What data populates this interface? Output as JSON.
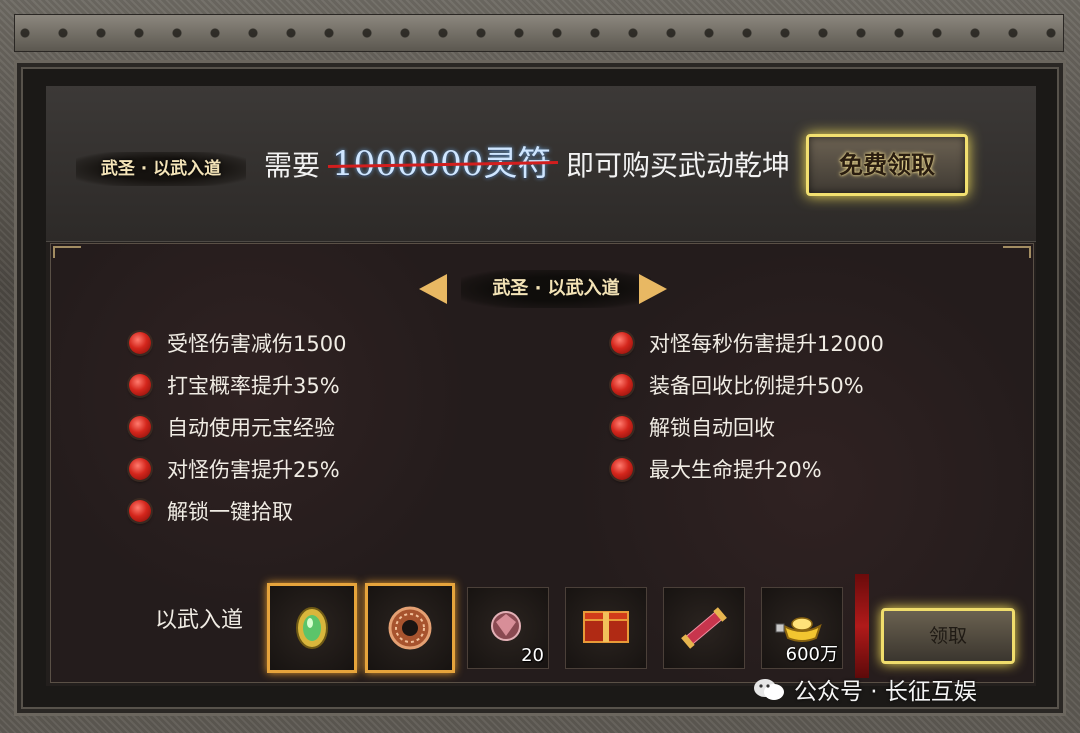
{
  "banner": {
    "badge": "武圣 · 以武入道",
    "need_text": "需要",
    "price": "1000000灵符",
    "suffix": "即可购买武动乾坤",
    "free_button": "免费领取"
  },
  "tier": {
    "title": "武圣 · 以武入道",
    "left_perks": [
      "受怪伤害减伤1500",
      "打宝概率提升35%",
      "自动使用元宝经验",
      "对怪伤害提升25%",
      "解锁一键拾取"
    ],
    "right_perks": [
      "对怪每秒伤害提升12000",
      "装备回收比例提升50%",
      "解锁自动回收",
      "最大生命提升20%"
    ]
  },
  "rewards": {
    "label": "以武入道",
    "items": [
      {
        "icon": "green-amulet-icon",
        "count": "",
        "highlighted": true
      },
      {
        "icon": "bronze-ring-icon",
        "count": "",
        "highlighted": true
      },
      {
        "icon": "red-gem-icon",
        "count": "20",
        "highlighted": false
      },
      {
        "icon": "gift-box-icon",
        "count": "",
        "highlighted": false
      },
      {
        "icon": "scroll-icon",
        "count": "",
        "highlighted": false
      },
      {
        "icon": "gold-ingot-icon",
        "count": "600万",
        "highlighted": false
      }
    ],
    "claim_button": "领取"
  },
  "watermark": "公众号 · 长征互娱",
  "colors": {
    "accent_gold": "#f0dd6c",
    "perk_dot": "#d4261c",
    "price_strike": "#d21e1e"
  }
}
